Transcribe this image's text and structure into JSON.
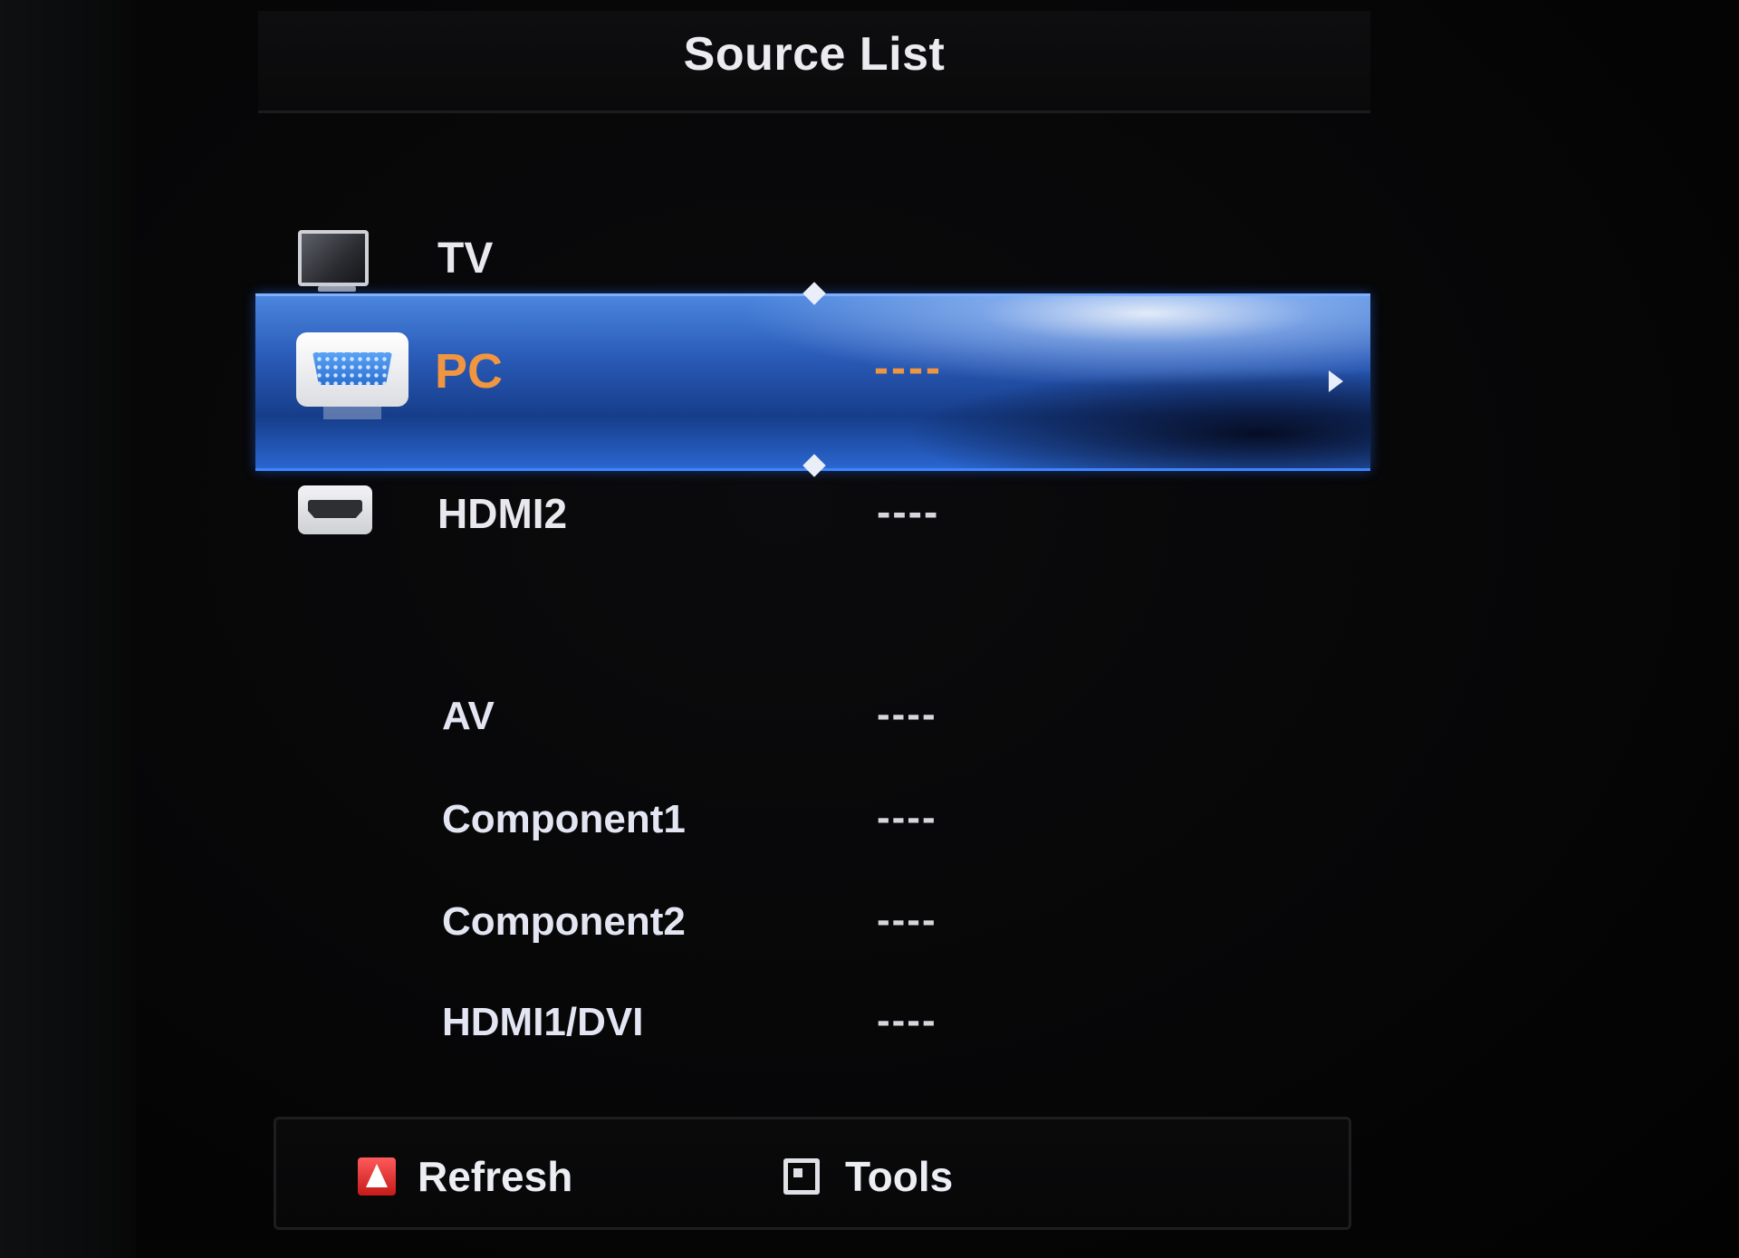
{
  "screen": {
    "title": "Source List"
  },
  "sources": {
    "tv": {
      "label": "TV"
    },
    "pc": {
      "label": "PC",
      "value": "----"
    },
    "hdmi2": {
      "label": "HDMI2",
      "value": "----"
    },
    "av": {
      "label": "AV",
      "value": "----"
    },
    "component1": {
      "label": "Component1",
      "value": "----"
    },
    "component2": {
      "label": "Component2",
      "value": "----"
    },
    "hdmi1dvi": {
      "label": "HDMI1/DVI",
      "value": "----"
    }
  },
  "footer": {
    "refresh_label": "Refresh",
    "tools_label": "Tools"
  },
  "colors": {
    "selected_text": "#f09640",
    "highlight": "#2a5bb8",
    "refresh_button": "#c51a1a"
  },
  "icons": {
    "tv": "tv-icon",
    "pc": "vga-connector-icon",
    "hdmi2": "hdmi-connector-icon",
    "refresh": "red-a-button-icon",
    "tools": "tools-icon",
    "next": "arrow-right-icon"
  }
}
